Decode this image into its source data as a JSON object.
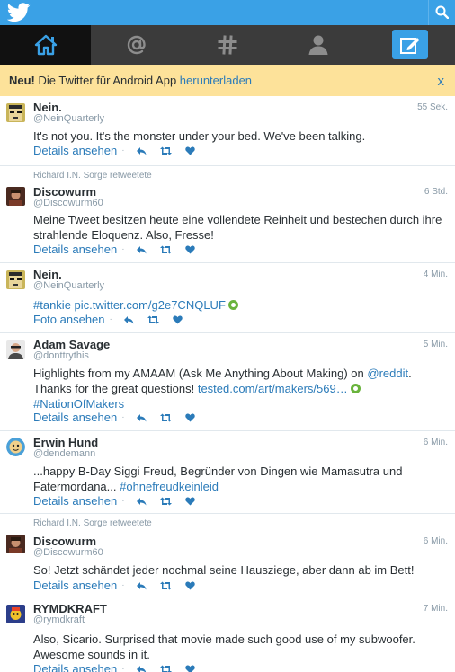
{
  "banner": {
    "new_label": "Neu!",
    "text": " Die Twitter für Android App ",
    "link": "herunterladen",
    "close": "x"
  },
  "colors": {
    "brand": "#3aa1e6",
    "navbar": "#3b3b3b",
    "banner": "#fde29a",
    "link": "#2b7bb9"
  },
  "tweets": [
    {
      "name": "Nein.",
      "handle": "@NeinQuarterly",
      "time": "55 Sek.",
      "text": "It's not you. It's the monster under your bed. We've been talking.",
      "action": "Details ansehen",
      "avatar_icon": "nein-avatar"
    },
    {
      "retweeted_by": "Richard I.N. Sorge retweetete",
      "name": "Discowurm",
      "handle": "@Discowurm60",
      "time": "6 Std.",
      "text": "Meine Tweet besitzen heute eine vollendete Reinheit und bestechen durch ihre strahlende Eloquenz. Also, Fresse!",
      "action": "Details ansehen",
      "avatar_icon": "discowurm-avatar"
    },
    {
      "name": "Nein.",
      "handle": "@NeinQuarterly",
      "time": "4 Min.",
      "link1": "#tankie",
      "link2": "pic.twitter.com/g2e7CNQLUF",
      "action": "Foto ansehen",
      "avatar_icon": "nein-avatar"
    },
    {
      "name": "Adam Savage",
      "handle": "@donttrythis",
      "time": "5 Min.",
      "text1": "Highlights from my AMAAM (Ask Me Anything About Making) on ",
      "link1": "@reddit",
      "text2": ". Thanks for the great questions! ",
      "link2": "tested.com/art/makers/569…",
      "link3": "#NationOfMakers",
      "action": "Details ansehen",
      "avatar_icon": "adam-savage-avatar"
    },
    {
      "name": "Erwin Hund",
      "handle": "@dendemann",
      "time": "6 Min.",
      "text1": "...happy B-Day Siggi Freud, Begründer von Dingen wie Mamasutra und Fatermordana... ",
      "link1": "#ohnefreudkeinleid",
      "action": "Details ansehen",
      "avatar_icon": "erwin-hund-avatar"
    },
    {
      "retweeted_by": "Richard I.N. Sorge retweetete",
      "name": "Discowurm",
      "handle": "@Discowurm60",
      "time": "6 Min.",
      "text": "So! Jetzt schändet jeder nochmal seine Hausziege, aber dann ab im Bett!",
      "action": "Details ansehen",
      "avatar_icon": "discowurm-avatar"
    },
    {
      "name": "RYMDKRAFT",
      "handle": "@rymdkraft",
      "time": "7 Min.",
      "text": "Also, Sicario. Surprised that movie made such good use of my subwoofer. Awesome sounds in it.",
      "action": "Details ansehen",
      "avatar_icon": "rymdkraft-avatar"
    }
  ]
}
